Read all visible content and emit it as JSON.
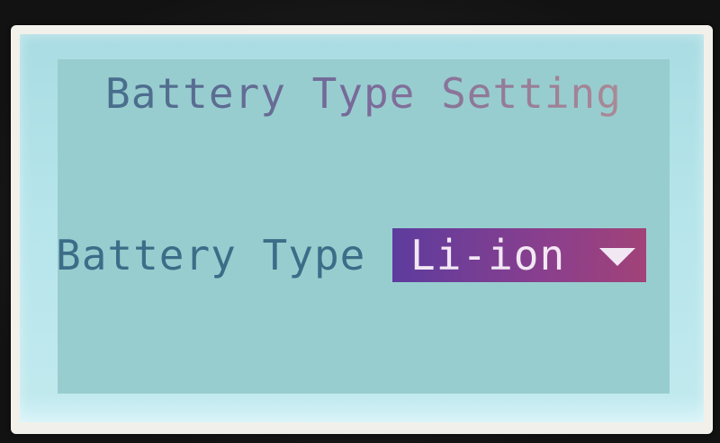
{
  "screen": {
    "title": "Battery Type Setting"
  },
  "setting": {
    "label": "Battery Type",
    "value": "Li-ion",
    "icon": "chevron-down-icon"
  },
  "colors": {
    "lcd_background": "#98cdcf",
    "text_primary": "#3c6d88",
    "highlight": "#8a3f8d",
    "highlight_text": "#f2e8f4"
  }
}
